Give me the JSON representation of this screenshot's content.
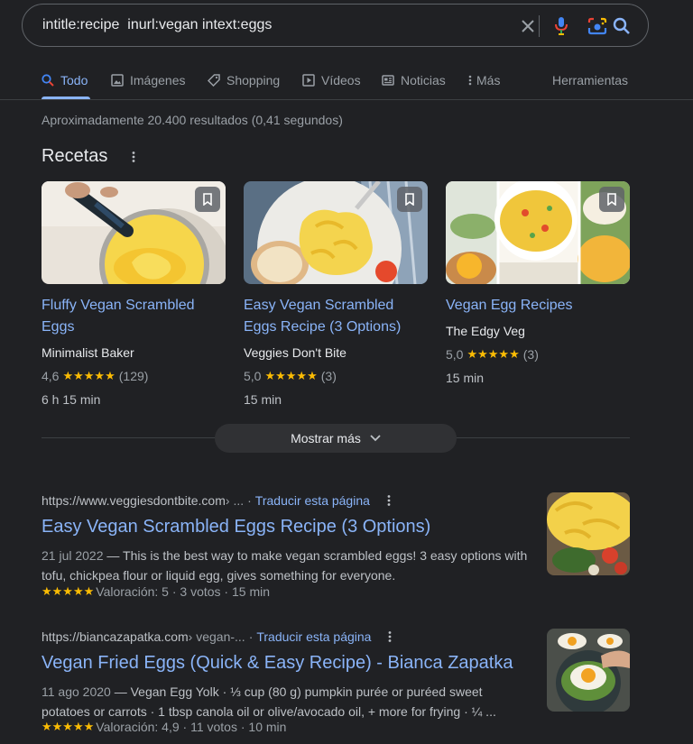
{
  "search": {
    "query": "intitle:recipe  inurl:vegan intext:eggs"
  },
  "tabs": [
    {
      "label": "Todo",
      "icon": "search-icon",
      "active": true
    },
    {
      "label": "Imágenes",
      "icon": "image-icon"
    },
    {
      "label": "Shopping",
      "icon": "tag-icon"
    },
    {
      "label": "Vídeos",
      "icon": "play-icon"
    },
    {
      "label": "Noticias",
      "icon": "news-icon"
    },
    {
      "label": "Más",
      "icon": "more-vert-icon"
    }
  ],
  "tools_label": "Herramientas",
  "result_stats": "Aproximadamente 20.400 resultados (0,41 segundos)",
  "recipes": {
    "heading": "Recetas",
    "cards": [
      {
        "title": "Fluffy Vegan Scrambled Eggs",
        "source": "Minimalist Baker",
        "rating": "4,6",
        "stars": "★★★★★",
        "reviews": "(129)",
        "time": "6 h 15 min"
      },
      {
        "title": "Easy Vegan Scrambled Eggs Recipe (3 Options)",
        "source": "Veggies Don't Bite",
        "rating": "5,0",
        "stars": "★★★★★",
        "reviews": "(3)",
        "time": "15 min"
      },
      {
        "title": "Vegan Egg Recipes",
        "source": "The Edgy Veg",
        "rating": "5,0",
        "stars": "★★★★★",
        "reviews": "(3)",
        "time": "15 min"
      }
    ],
    "show_more": "Mostrar más"
  },
  "results": [
    {
      "url_host": "https://www.veggiesdontbite.com",
      "url_path": " › ...",
      "translate": "Traducir esta página",
      "title": "Easy Vegan Scrambled Eggs Recipe (3 Options)",
      "date": "21 jul 2022",
      "snippet": " — This is the best way to make vegan scrambled eggs! 3 easy options with tofu, chickpea flour or liquid egg, gives something for everyone.",
      "stars": "★★★★★",
      "meta": "Valoración: 5 · 3 votos · 15 min"
    },
    {
      "url_host": "https://biancazapatka.com",
      "url_path": " › vegan-...",
      "translate": "Traducir esta página",
      "title": "Vegan Fried Eggs (Quick & Easy Recipe) - Bianca Zapatka",
      "date": "11 ago 2020",
      "snippet": " — Vegan Egg Yolk · ⅓ cup (80 g) pumpkin purée or puréed sweet potatoes or carrots · 1 tbsp canola oil or olive/avocado oil, + more for frying · ¼ ...",
      "stars": "★★★★★",
      "meta": "Valoración: 4,9 · 11 votos · 10 min"
    }
  ],
  "colors": {
    "background": "#202124",
    "link": "#8ab4f8",
    "star": "#fbbc04",
    "text": "#bdc1c6"
  }
}
